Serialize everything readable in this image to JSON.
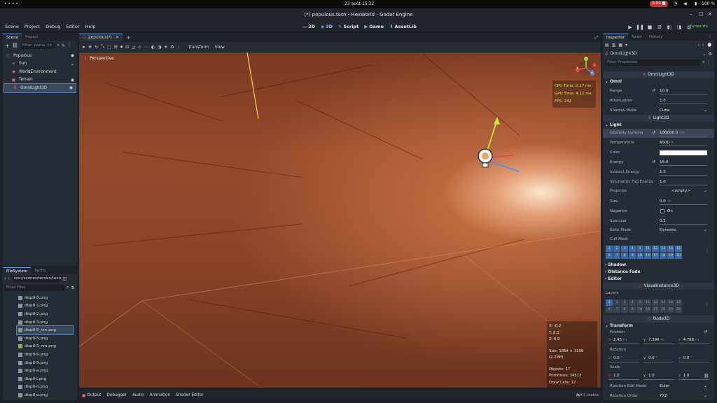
{
  "system": {
    "date": "23 août 15:32",
    "recording": "0:00",
    "battery": "100 %"
  },
  "window": {
    "title": "(*) populous.tscn - HexWorld - Godot Engine"
  },
  "menu": [
    "Scene",
    "Project",
    "Debug",
    "Editor",
    "Help"
  ],
  "workspaces": [
    {
      "icon": "▭",
      "label": "2D"
    },
    {
      "icon": "◈",
      "label": "3D"
    },
    {
      "icon": "✎",
      "label": "Script"
    },
    {
      "icon": "▶",
      "label": "Game"
    },
    {
      "icon": "⬇",
      "label": "AssetLib"
    }
  ],
  "renderer": "Forward+",
  "scene_dock": {
    "tabs": [
      "Scene",
      "Import"
    ],
    "filter_placeholder": "Filter: name, t:t",
    "nodes": [
      {
        "name": "Populous",
        "icon": "○",
        "color": "#e76b6b",
        "visible": true
      },
      {
        "name": "Sun",
        "icon": "☀",
        "color": "#e76b6b",
        "visible": true
      },
      {
        "name": "WorldEnvironment",
        "icon": "◉",
        "color": "#e76b6b",
        "visible": false
      },
      {
        "name": "Terrain",
        "icon": "▣",
        "color": "#e76b6b",
        "visible": true
      },
      {
        "name": "OmniLight3D",
        "icon": "♁",
        "color": "#e76b6b",
        "visible": true
      }
    ]
  },
  "filesystem": {
    "tabs": [
      "FileSystem",
      "Sprits"
    ],
    "path": "res://scenes/terrain/textur",
    "filter_placeholder": "Filter Files",
    "files": [
      "disp0-0.png",
      "disp0-1.png",
      "disp0-2.png",
      "disp0-3.png",
      "disp0-5_nm.png",
      "disp0-5.png",
      "disp0-5_nm.png",
      "disp0-6.png",
      "disp0-9.png",
      "disp0-a.png",
      "disp0-l.png",
      "disp0-n.png",
      "disp0-o.png"
    ]
  },
  "editor_tabs": {
    "scene": "populous(*)"
  },
  "viewport_toolbar": {
    "transform": "Transform",
    "view": "View"
  },
  "viewport": {
    "label": "Perspective",
    "stats": {
      "cpu": "CPU Time: 0.27 ms",
      "gpu": "GPU Time: 4.12 ms",
      "fps": "FPS: 242"
    },
    "coords": {
      "x": "X: -0.2",
      "y": "Y: 8.3",
      "z": "Z: 6.9"
    },
    "size": "Size: 1864 × 1199 (2.2MP)",
    "objects": "Objects: 17",
    "primitives": "Primitives: 34513",
    "draw_calls": "Draw Calls: 17",
    "gizmo": {
      "y": "Y",
      "x": "X",
      "z": "Z"
    }
  },
  "bottom_tabs": [
    "Output",
    "Debugger",
    "Audio",
    "Animation",
    "Shader Editor"
  ],
  "version": "4.4.1.stable",
  "inspector": {
    "tabs": [
      "Inspector",
      "Node",
      "History"
    ],
    "node": "OmniLight3D",
    "filter_placeholder": "Filter Properties",
    "class_omni": "OmniLight3D",
    "omni_group": "Omni",
    "range": {
      "label": "Range",
      "value": "10.0"
    },
    "attenuation": {
      "label": "Attenuation",
      "value": "1.0"
    },
    "shadow_mode": {
      "label": "Shadow Mode",
      "value": "Cube"
    },
    "class_light": "Light3D",
    "light_group": "Light",
    "intensity": {
      "label": "Intensity Lumens",
      "value": "100000.0",
      "unit": "lm"
    },
    "temperature": {
      "label": "Temperature",
      "value": "6500",
      "unit": "K"
    },
    "color": {
      "label": "Color",
      "value": "#ffffff"
    },
    "energy": {
      "label": "Energy",
      "value": "16.0"
    },
    "indirect": {
      "label": "Indirect Energy",
      "value": "1.0"
    },
    "fog": {
      "label": "Volumetric Fog Energy",
      "value": "1.0"
    },
    "projector": {
      "label": "Projector",
      "value": "<empty>"
    },
    "size": {
      "label": "Size",
      "value": "0.0",
      "unit": "m"
    },
    "negative": {
      "label": "Negative",
      "value": "On"
    },
    "specular": {
      "label": "Specular",
      "value": "0.5"
    },
    "bake_mode": {
      "label": "Bake Mode",
      "value": "Dynamic"
    },
    "cull_mask": {
      "label": "Cull Mask",
      "bits": [
        "1",
        "2",
        "3",
        "4",
        "5",
        "11",
        "12",
        "13",
        "14",
        "15",
        "6",
        "7",
        "8",
        "9",
        "10",
        "16",
        "17",
        "18",
        "19",
        "20"
      ]
    },
    "groups": [
      "Shadow",
      "Distance Fade",
      "Editor"
    ],
    "class_visual": "VisualInstance3D",
    "layers": {
      "label": "Layers",
      "bits": [
        "1",
        "2",
        "3",
        "4",
        "5",
        "11",
        "12",
        "13",
        "14",
        "15",
        "6",
        "7",
        "8",
        "9",
        "10",
        "16",
        "17",
        "18",
        "19",
        "20"
      ]
    },
    "class_node3d": "Node3D",
    "transform_group": "Transform",
    "position": {
      "label": "Position",
      "x": "2.45",
      "y": "7.394",
      "z": "4.788",
      "unit": "m"
    },
    "rotation": {
      "label": "Rotation",
      "x": "0.0",
      "y": "0.0",
      "z": "0.0",
      "unit": "°"
    },
    "scale": {
      "label": "Scale",
      "x": "1.0",
      "y": "1.0",
      "z": "1.0"
    },
    "rotation_edit_mode": {
      "label": "Rotation Edit Mode",
      "value": "Euler"
    },
    "rotation_order": {
      "label": "Rotation Order",
      "value": "YXZ"
    }
  }
}
